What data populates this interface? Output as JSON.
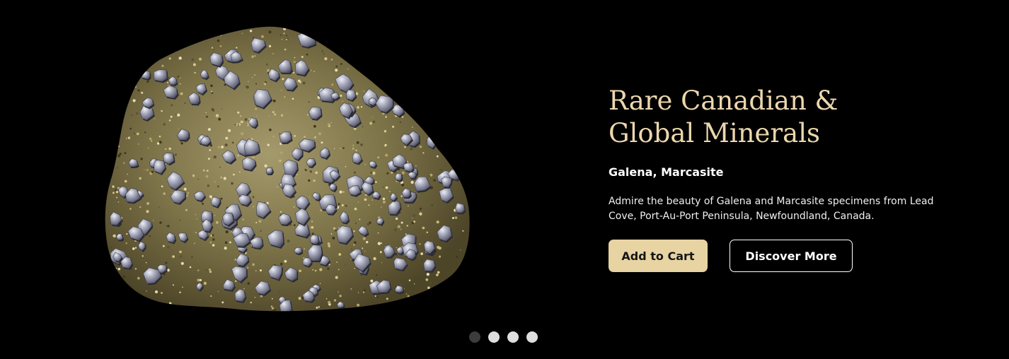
{
  "hero": {
    "title": "Rare Canadian & Global Minerals",
    "subtitle": "Galena, Marcasite",
    "description": "Admire the beauty of Galena and Marcasite specimens from Lead Cove, Port-Au-Port Peninsula, Newfoundland, Canada.",
    "add_to_cart_label": "Add to Cart",
    "discover_label": "Discover More"
  },
  "carousel": {
    "slide_count": 4,
    "active_index": 0
  },
  "colors": {
    "background": "#000000",
    "accent": "#e8d3a3",
    "title": "#ecd7ad"
  }
}
